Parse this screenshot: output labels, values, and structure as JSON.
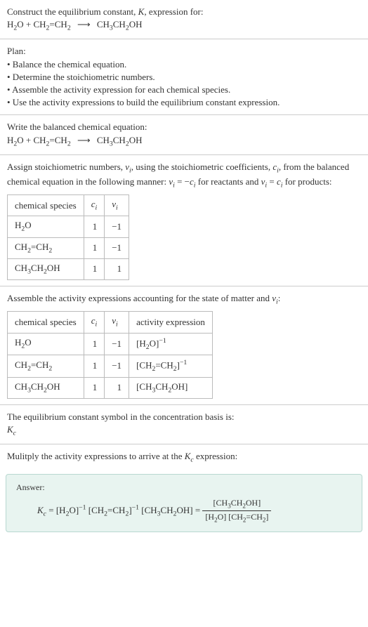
{
  "intro": {
    "line1": "Construct the equilibrium constant, ",
    "k": "K",
    "line1b": ", expression for:",
    "equation_html": "H<span class='sub'>2</span>O + CH<span class='sub'>2</span>=CH<span class='sub'>2</span> <span class='arrow'>⟶</span> CH<span class='sub'>3</span>CH<span class='sub'>2</span>OH"
  },
  "plan": {
    "title": "Plan:",
    "items": [
      "• Balance the chemical equation.",
      "• Determine the stoichiometric numbers.",
      "• Assemble the activity expression for each chemical species.",
      "• Use the activity expressions to build the equilibrium constant expression."
    ]
  },
  "balanced": {
    "title": "Write the balanced chemical equation:",
    "equation_html": "H<span class='sub'>2</span>O + CH<span class='sub'>2</span>=CH<span class='sub'>2</span> <span class='arrow'>⟶</span> CH<span class='sub'>3</span>CH<span class='sub'>2</span>OH"
  },
  "stoich": {
    "intro_html": "Assign stoichiometric numbers, <span class='italic'>ν<span class='sub'>i</span></span>, using the stoichiometric coefficients, <span class='italic'>c<span class='sub'>i</span></span>, from the balanced chemical equation in the following manner: <span class='italic'>ν<span class='sub'>i</span></span> = −<span class='italic'>c<span class='sub'>i</span></span> for reactants and <span class='italic'>ν<span class='sub'>i</span></span> = <span class='italic'>c<span class='sub'>i</span></span> for products:",
    "headers": [
      "chemical species",
      "c_i",
      "ν_i"
    ],
    "rows": [
      {
        "species_html": "H<span class='sub'>2</span>O",
        "c": "1",
        "v": "−1"
      },
      {
        "species_html": "CH<span class='sub'>2</span>=CH<span class='sub'>2</span>",
        "c": "1",
        "v": "−1"
      },
      {
        "species_html": "CH<span class='sub'>3</span>CH<span class='sub'>2</span>OH",
        "c": "1",
        "v": "1"
      }
    ]
  },
  "activity": {
    "intro_html": "Assemble the activity expressions accounting for the state of matter and <span class='italic'>ν<span class='sub'>i</span></span>:",
    "headers": [
      "chemical species",
      "c_i",
      "ν_i",
      "activity expression"
    ],
    "rows": [
      {
        "species_html": "H<span class='sub'>2</span>O",
        "c": "1",
        "v": "−1",
        "act_html": "[H<span class='sub'>2</span>O]<span class='sup'>−1</span>"
      },
      {
        "species_html": "CH<span class='sub'>2</span>=CH<span class='sub'>2</span>",
        "c": "1",
        "v": "−1",
        "act_html": "[CH<span class='sub'>2</span>=CH<span class='sub'>2</span>]<span class='sup'>−1</span>"
      },
      {
        "species_html": "CH<span class='sub'>3</span>CH<span class='sub'>2</span>OH",
        "c": "1",
        "v": "1",
        "act_html": "[CH<span class='sub'>3</span>CH<span class='sub'>2</span>OH]"
      }
    ]
  },
  "symbol": {
    "line1": "The equilibrium constant symbol in the concentration basis is:",
    "kc_html": "<span class='italic'>K<span class='sub'>c</span></span>"
  },
  "multiply": {
    "text_html": "Mulitply the activity expressions to arrive at the <span class='italic'>K<span class='sub'>c</span></span> expression:"
  },
  "answer": {
    "label": "Answer:",
    "lhs_html": "<span class='italic'>K<span class='sub'>c</span></span> = [H<span class='sub'>2</span>O]<span class='sup'>−1</span> [CH<span class='sub'>2</span>=CH<span class='sub'>2</span>]<span class='sup'>−1</span> [CH<span class='sub'>3</span>CH<span class='sub'>2</span>OH] = ",
    "frac_num_html": "[CH<span class='sub'>3</span>CH<span class='sub'>2</span>OH]",
    "frac_den_html": "[H<span class='sub'>2</span>O] [CH<span class='sub'>2</span>=CH<span class='sub'>2</span>]"
  }
}
